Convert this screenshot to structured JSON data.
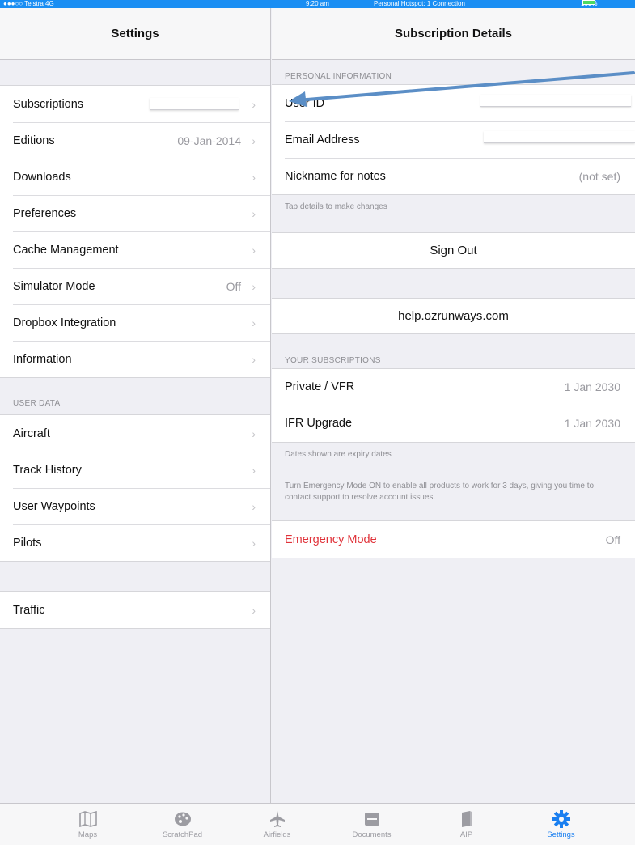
{
  "status_bar": {
    "carrier": "●●●○○ Telstra  4G",
    "time": "9:20 am",
    "hotspot": "Personal Hotspot: 1 Connection",
    "battery": "100%"
  },
  "settings": {
    "title": "Settings",
    "main_items": [
      {
        "label": "Subscriptions",
        "value": ""
      },
      {
        "label": "Editions",
        "value": "09-Jan-2014"
      },
      {
        "label": "Downloads",
        "value": ""
      },
      {
        "label": "Preferences",
        "value": ""
      },
      {
        "label": "Cache Management",
        "value": ""
      },
      {
        "label": "Simulator Mode",
        "value": "Off"
      },
      {
        "label": "Dropbox Integration",
        "value": ""
      },
      {
        "label": "Information",
        "value": ""
      }
    ],
    "user_data_header": "USER DATA",
    "user_data_items": [
      {
        "label": "Aircraft"
      },
      {
        "label": "Track History"
      },
      {
        "label": "User Waypoints"
      },
      {
        "label": "Pilots"
      }
    ],
    "traffic_label": "Traffic"
  },
  "details": {
    "title": "Subscription Details",
    "personal_header": "PERSONAL INFORMATION",
    "personal_items": [
      {
        "label": "User ID",
        "value": ""
      },
      {
        "label": "Email Address",
        "value": ""
      },
      {
        "label": "Nickname for notes",
        "value": "(not set)"
      }
    ],
    "personal_footer": "Tap details to make changes",
    "sign_out": "Sign Out",
    "help_link": "help.ozrunways.com",
    "subscriptions_header": "YOUR SUBSCRIPTIONS",
    "subscriptions": [
      {
        "label": "Private / VFR",
        "value": "1 Jan 2030"
      },
      {
        "label": "IFR Upgrade",
        "value": "1 Jan 2030"
      }
    ],
    "subscriptions_footer": "Dates shown are expiry dates",
    "emergency_note": "Turn Emergency Mode ON to enable all products to work for 3 days, giving you time to contact support to resolve account issues.",
    "emergency_label": "Emergency Mode",
    "emergency_value": "Off"
  },
  "tabs": [
    {
      "label": "Maps",
      "icon": "map-icon"
    },
    {
      "label": "ScratchPad",
      "icon": "palette-icon"
    },
    {
      "label": "Airfields",
      "icon": "airplane-icon"
    },
    {
      "label": "Documents",
      "icon": "folder-icon"
    },
    {
      "label": "AIP",
      "icon": "book-icon"
    },
    {
      "label": "Settings",
      "icon": "gear-icon",
      "active": true
    }
  ],
  "colors": {
    "accent": "#1a7ff0",
    "status_bar": "#1a8ef3",
    "danger": "#e0333a",
    "annotation_arrow": "#5b8ec6"
  }
}
